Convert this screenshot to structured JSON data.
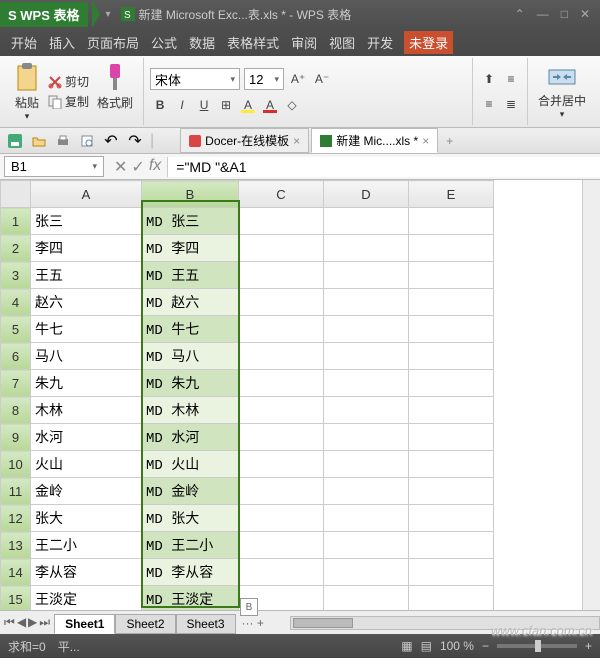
{
  "app": {
    "badge": "S WPS 表格",
    "doc_title": "新建 Microsoft Exc...表.xls * - WPS 表格"
  },
  "menu": [
    "开始",
    "插入",
    "页面布局",
    "公式",
    "数据",
    "表格样式",
    "审阅",
    "视图",
    "开发"
  ],
  "login": "未登录",
  "clipboard": {
    "cut": "剪切",
    "copy": "复制",
    "paste": "粘贴",
    "format_painter": "格式刷"
  },
  "font": {
    "name": "宋体",
    "size": "12"
  },
  "merge": "合并居中",
  "doc_tabs": [
    {
      "label": "Docer-在线模板"
    },
    {
      "label": "新建 Mic....xls *"
    }
  ],
  "namebox": "B1",
  "formula": "=\"MD \"&A1",
  "fx": "fx",
  "columns": [
    "A",
    "B",
    "C",
    "D",
    "E"
  ],
  "rows": [
    {
      "n": 1,
      "a": "张三",
      "b": "MD 张三"
    },
    {
      "n": 2,
      "a": "李四",
      "b": "MD 李四"
    },
    {
      "n": 3,
      "a": "王五",
      "b": "MD 王五"
    },
    {
      "n": 4,
      "a": "赵六",
      "b": "MD 赵六"
    },
    {
      "n": 5,
      "a": "牛七",
      "b": "MD 牛七"
    },
    {
      "n": 6,
      "a": "马八",
      "b": "MD 马八"
    },
    {
      "n": 7,
      "a": "朱九",
      "b": "MD 朱九"
    },
    {
      "n": 8,
      "a": "木林",
      "b": "MD 木林"
    },
    {
      "n": 9,
      "a": "水河",
      "b": "MD 水河"
    },
    {
      "n": 10,
      "a": "火山",
      "b": "MD 火山"
    },
    {
      "n": 11,
      "a": "金岭",
      "b": "MD 金岭"
    },
    {
      "n": 12,
      "a": "张大",
      "b": "MD 张大"
    },
    {
      "n": 13,
      "a": "王二小",
      "b": "MD 王二小"
    },
    {
      "n": 14,
      "a": "李从容",
      "b": "MD 李从容"
    },
    {
      "n": 15,
      "a": "王淡定",
      "b": "MD 王淡定"
    }
  ],
  "sheets": [
    "Sheet1",
    "Sheet2",
    "Sheet3"
  ],
  "sheet_more": "··· +",
  "status": {
    "sum": "求和=0",
    "avg": "平...",
    "zoom": "100 %"
  },
  "watermark": "www.cfan.com.cn",
  "paste_opt": "B"
}
